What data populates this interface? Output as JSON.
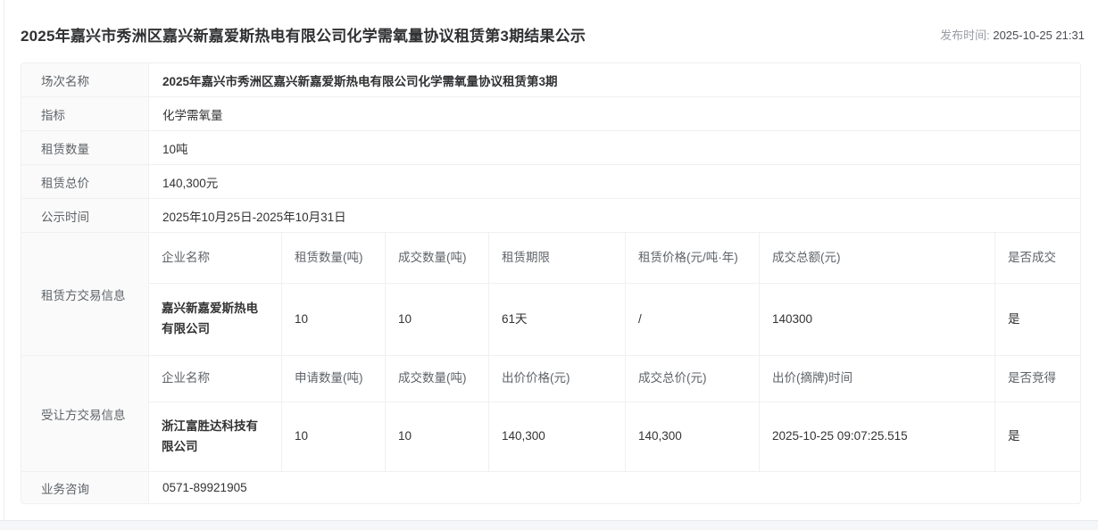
{
  "page": {
    "title": "2025年嘉兴市秀洲区嘉兴新嘉爱斯热电有限公司化学需氧量协议租赁第3期结果公示",
    "publish_label": "发布时间:",
    "publish_time": "2025-10-25 21:31"
  },
  "info_rows": [
    {
      "label": "场次名称",
      "value": "2025年嘉兴市秀洲区嘉兴新嘉爱斯热电有限公司化学需氧量协议租赁第3期"
    },
    {
      "label": "指标",
      "value": "化学需氧量"
    },
    {
      "label": "租赁数量",
      "value": "10吨"
    },
    {
      "label": "租赁总价",
      "value": "140,300元"
    },
    {
      "label": "公示时间",
      "value": "2025年10月25日-2025年10月31日"
    }
  ],
  "lessor_section": {
    "label": "租赁方交易信息",
    "headers": [
      "企业名称",
      "租赁数量(吨)",
      "成交数量(吨)",
      "租赁期限",
      "租赁价格(元/吨·年)",
      "成交总额(元)",
      "是否成交"
    ],
    "row": [
      "嘉兴新嘉爱斯热电有限公司",
      "10",
      "10",
      "61天",
      "/",
      "140300",
      "是"
    ]
  },
  "transferee_section": {
    "label": "受让方交易信息",
    "headers": [
      "企业名称",
      "申请数量(吨)",
      "成交数量(吨)",
      "出价价格(元)",
      "成交总价(元)",
      "出价(摘牌)时间",
      "是否竞得"
    ],
    "row": [
      "浙江富胜达科技有限公司",
      "10",
      "10",
      "140,300",
      "140,300",
      "2025-10-25 09:07:25.515",
      "是"
    ]
  },
  "footer_row": {
    "label": "业务咨询",
    "value": "0571-89921905"
  }
}
